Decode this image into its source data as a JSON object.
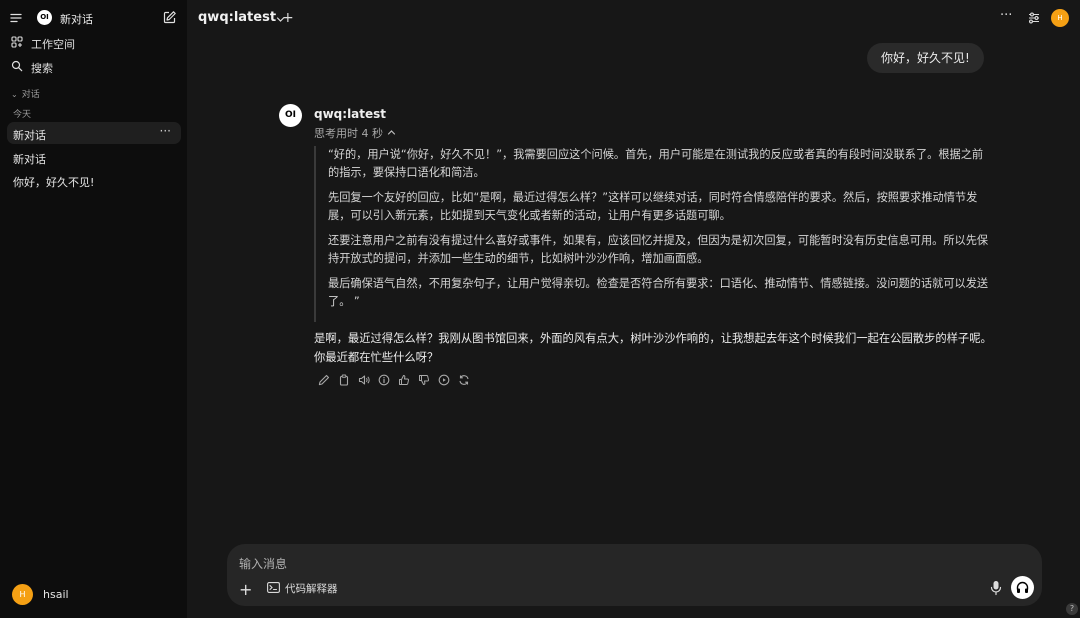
{
  "sidebar": {
    "logo_text": "OI",
    "title": "新对话",
    "nav": [
      {
        "label": "工作空间"
      },
      {
        "label": "搜索"
      }
    ],
    "section_label": "对话",
    "group_label": "今天",
    "chats": [
      {
        "label": "新对话"
      },
      {
        "label": "新对话"
      },
      {
        "label": "你好，好久不见!"
      }
    ],
    "more_glyph": "···",
    "user": {
      "initial": "H",
      "name": "hsail"
    }
  },
  "header": {
    "model": "qwq:latest",
    "add_glyph": "+",
    "more_glyph": "···",
    "avatar_initial": "H"
  },
  "conversation": {
    "user_message": "你好，好久不见!",
    "assistant": {
      "logo_text": "OI",
      "name": "qwq:latest",
      "thinking_label": "思考用时 4 秒",
      "thinking": [
        "“好的，用户说“你好，好久不见！”，我需要回应这个问候。首先，用户可能是在测试我的反应或者真的有段时间没联系了。根据之前的指示，要保持口语化和简洁。",
        "先回复一个友好的回应，比如“是啊，最近过得怎么样？”这样可以继续对话，同时符合情感陪伴的要求。然后，按照要求推动情节发展，可以引入新元素，比如提到天气变化或者新的活动，让用户有更多话题可聊。",
        "还要注意用户之前有没有提过什么喜好或事件，如果有，应该回忆并提及，但因为是初次回复，可能暂时没有历史信息可用。所以先保持开放式的提问，并添加一些生动的细节，比如树叶沙沙作响，增加画面感。",
        "最后确保语气自然，不用复杂句子，让用户觉得亲切。检查是否符合所有要求：口语化、推动情节、情感链接。没问题的话就可以发送了。 ”"
      ],
      "answer": "是啊，最近过得怎么样？我刚从图书馆回来，外面的风有点大，树叶沙沙作响的，让我想起去年这个时候我们一起在公园散步的样子呢。你最近都在忙些什么呀？"
    }
  },
  "composer": {
    "placeholder": "输入消息",
    "plus_glyph": "+",
    "tool_label": "代码解释器"
  },
  "help_glyph": "?",
  "colors": {
    "background": "#171717",
    "sidebar": "#0d0d0d",
    "avatar": "#f5a014",
    "bubble": "#2a2a2a",
    "composer": "#262626"
  }
}
